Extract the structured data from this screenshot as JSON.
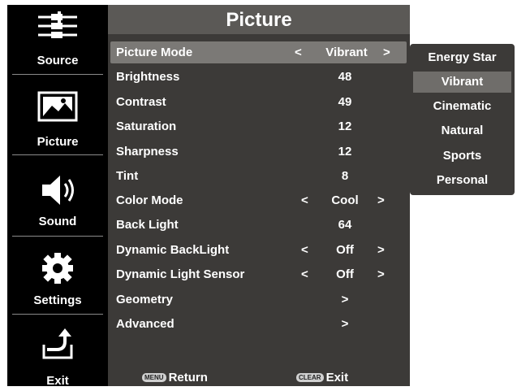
{
  "sidebar": {
    "items": [
      {
        "label": "Source",
        "icon": "av-cables-icon"
      },
      {
        "label": "Picture",
        "icon": "picture-icon"
      },
      {
        "label": "Sound",
        "icon": "speaker-icon"
      },
      {
        "label": "Settings",
        "icon": "gear-icon"
      },
      {
        "label": "Exit",
        "icon": "exit-icon"
      }
    ]
  },
  "menu": {
    "title": "Picture",
    "rows": [
      {
        "name": "Picture Mode",
        "left": "<",
        "value": "Vibrant",
        "right": ">"
      },
      {
        "name": "Brightness",
        "left": "",
        "value": "48",
        "right": ""
      },
      {
        "name": "Contrast",
        "left": "",
        "value": "49",
        "right": ""
      },
      {
        "name": "Saturation",
        "left": "",
        "value": "12",
        "right": ""
      },
      {
        "name": "Sharpness",
        "left": "",
        "value": "12",
        "right": ""
      },
      {
        "name": "Tint",
        "left": "",
        "value": "8",
        "right": ""
      },
      {
        "name": "Color Mode",
        "left": "<",
        "value": "Cool",
        "right": ">"
      },
      {
        "name": "Back Light",
        "left": "",
        "value": "64",
        "right": ""
      },
      {
        "name": "Dynamic BackLight",
        "left": "<",
        "value": "Off",
        "right": ">"
      },
      {
        "name": "Dynamic Light Sensor",
        "left": "<",
        "value": "Off",
        "right": ">"
      },
      {
        "name": "Geometry",
        "left": "",
        "value": ">",
        "right": ""
      },
      {
        "name": "Advanced",
        "left": "",
        "value": ">",
        "right": ""
      }
    ]
  },
  "footer": {
    "menu_key": "MENU",
    "return_label": "Return",
    "clear_key": "CLEAR",
    "exit_label": "Exit"
  },
  "dropdown": {
    "options": [
      "Energy Star",
      "Vibrant",
      "Cinematic",
      "Natural",
      "Sports",
      "Personal"
    ],
    "selected": "Vibrant"
  },
  "colors": {
    "panel": "#3c3a38",
    "title_bar": "#5b5956",
    "selected_row": "#7b7976",
    "sidebar": "#000000"
  }
}
